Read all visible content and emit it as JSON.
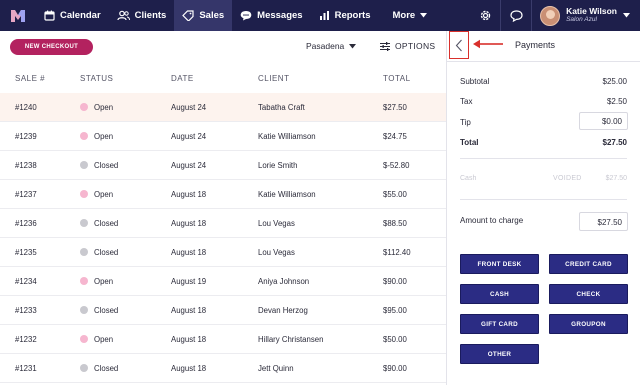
{
  "nav": {
    "items": [
      {
        "label": "Calendar",
        "icon": "calendar-icon"
      },
      {
        "label": "Clients",
        "icon": "clients-icon"
      },
      {
        "label": "Sales",
        "icon": "tag-icon"
      },
      {
        "label": "Messages",
        "icon": "chat-icon"
      },
      {
        "label": "Reports",
        "icon": "bar-chart-icon"
      }
    ],
    "more_label": "More",
    "user": {
      "name": "Katie Wilson",
      "salon": "Salon Azul"
    }
  },
  "toolbar": {
    "new_checkout_label": "NEW CHECKOUT",
    "location": "Pasadena",
    "options_label": "OPTIONS"
  },
  "table": {
    "headers": {
      "sale": "SALE #",
      "status": "STATUS",
      "date": "DATE",
      "client": "CLIENT",
      "total": "TOTAL"
    },
    "rows": [
      {
        "sale": "#1240",
        "status": "Open",
        "date": "August 24",
        "client": "Tabatha Craft",
        "total": "$27.50"
      },
      {
        "sale": "#1239",
        "status": "Open",
        "date": "August 24",
        "client": "Katie Williamson",
        "total": "$24.75"
      },
      {
        "sale": "#1238",
        "status": "Closed",
        "date": "August 24",
        "client": "Lorie Smith",
        "total": "$-52.80"
      },
      {
        "sale": "#1237",
        "status": "Open",
        "date": "August 18",
        "client": "Katie Williamson",
        "total": "$55.00"
      },
      {
        "sale": "#1236",
        "status": "Closed",
        "date": "August 18",
        "client": "Lou Vegas",
        "total": "$88.50"
      },
      {
        "sale": "#1235",
        "status": "Closed",
        "date": "August 18",
        "client": "Lou Vegas",
        "total": "$112.40"
      },
      {
        "sale": "#1234",
        "status": "Open",
        "date": "August 19",
        "client": "Aniya Johnson",
        "total": "$90.00"
      },
      {
        "sale": "#1233",
        "status": "Closed",
        "date": "August 18",
        "client": "Devan Herzog",
        "total": "$95.00"
      },
      {
        "sale": "#1232",
        "status": "Open",
        "date": "August 18",
        "client": "Hillary Christansen",
        "total": "$50.00"
      },
      {
        "sale": "#1231",
        "status": "Closed",
        "date": "August 18",
        "client": "Jett Quinn",
        "total": "$90.00"
      }
    ]
  },
  "payments": {
    "title": "Payments",
    "subtotal_label": "Subtotal",
    "subtotal": "$25.00",
    "tax_label": "Tax",
    "tax": "$2.50",
    "tip_label": "Tip",
    "tip": "$0.00",
    "total_label": "Total",
    "total": "$27.50",
    "cash_label": "Cash",
    "cash_status": "VOIDED",
    "cash_amount": "$27.50",
    "amount_label": "Amount to charge",
    "amount": "$27.50",
    "buttons": [
      "FRONT DESK",
      "CREDIT CARD",
      "CASH",
      "CHECK",
      "GIFT CARD",
      "GROUPON",
      "OTHER"
    ]
  },
  "colors": {
    "nav_bg": "#1e1f4b",
    "accent": "#b3225f",
    "pay_button": "#2b2c84",
    "open_dot": "#f6b6cf",
    "closed_dot": "#c9c9cf",
    "highlight_row": "#fdf3ee",
    "annotation_red": "#d9302c"
  }
}
